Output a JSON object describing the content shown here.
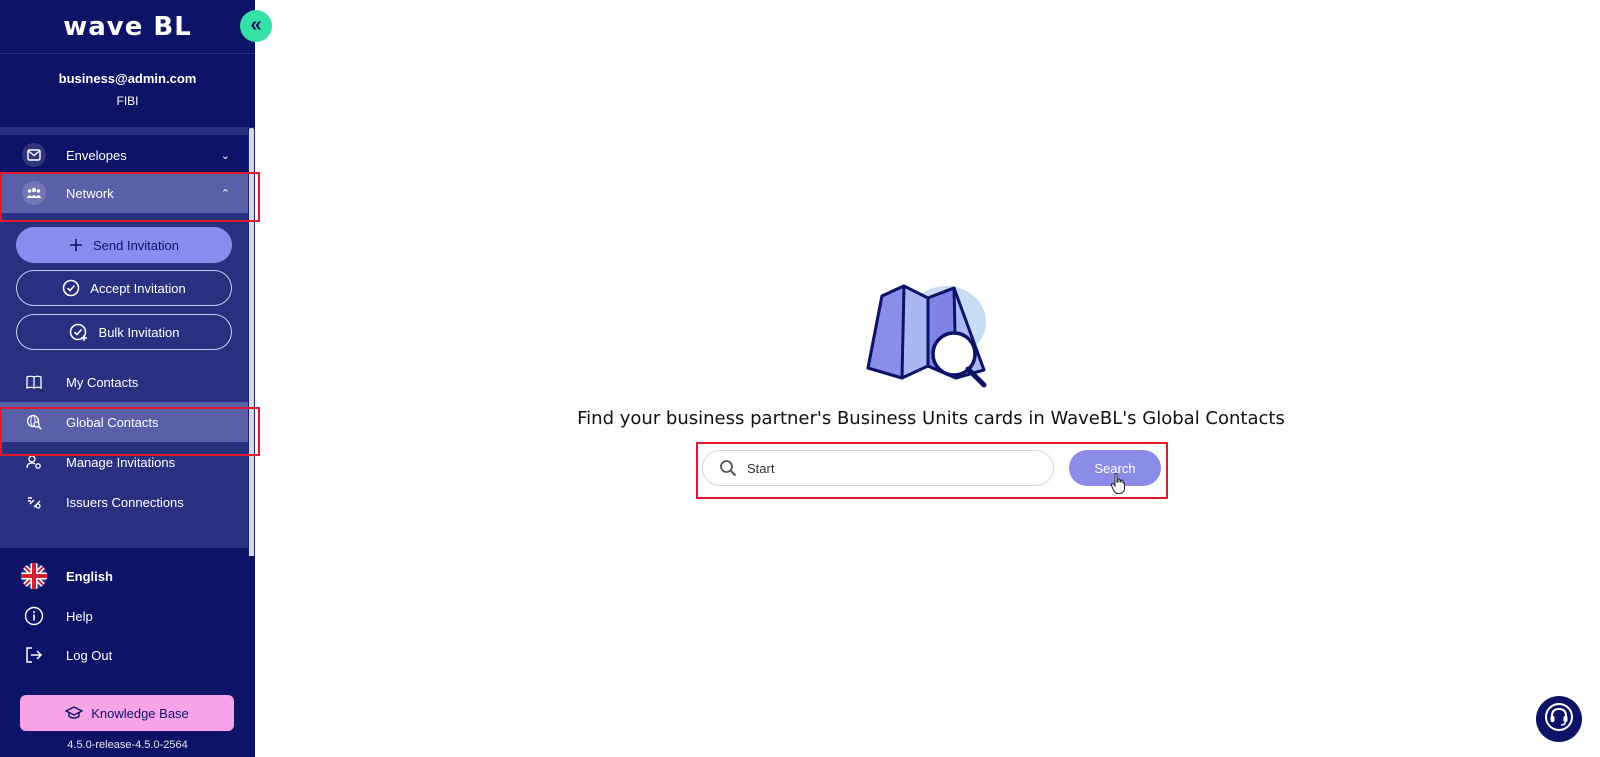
{
  "app": {
    "logo_text": "wave BL",
    "collapse_label": "«"
  },
  "user": {
    "email": "business@admin.com",
    "org": "FIBI"
  },
  "nav": {
    "envelopes": "Envelopes",
    "network": "Network",
    "send_invitation": "Send Invitation",
    "accept_invitation": "Accept Invitation",
    "bulk_invitation": "Bulk Invitation",
    "my_contacts": "My Contacts",
    "global_contacts": "Global Contacts",
    "manage_invitations": "Manage Invitations",
    "issuers_connections": "Issuers Connections"
  },
  "bottom": {
    "language": "English",
    "help": "Help",
    "logout": "Log Out",
    "knowledge_base": "Knowledge Base",
    "version": "4.5.0-release-4.5.0-2564"
  },
  "main": {
    "headline": "Find your business partner's Business Units cards in WaveBL's Global Contacts",
    "search": {
      "value": "Start",
      "button": "Search"
    }
  },
  "colors": {
    "sidebar_bg": "#0d1366",
    "accent_green": "#35e1a7",
    "button_purple": "#8c8cf0",
    "knowledge_pink": "#f6a3e8",
    "highlight_red": "#e11a2b"
  },
  "icons": {
    "envelopes": "envelope-icon",
    "network": "people-icon",
    "send": "plus-icon",
    "accept": "check-circle-icon",
    "bulk": "bulk-check-icon",
    "my_contacts": "book-icon",
    "global_contacts": "globe-search-icon",
    "manage": "user-settings-icon",
    "issuers": "connections-icon",
    "language": "uk-flag-icon",
    "help": "info-icon",
    "logout": "logout-icon",
    "kb": "graduation-cap-icon",
    "search": "search-icon",
    "support": "headset-icon"
  }
}
